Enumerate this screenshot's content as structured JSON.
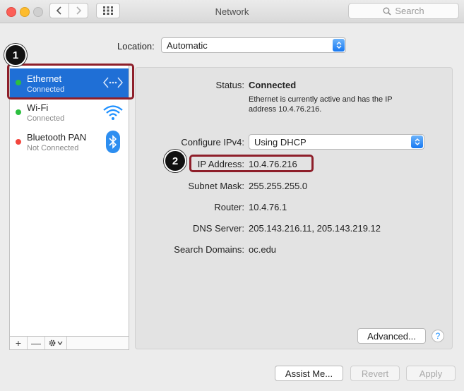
{
  "window": {
    "title": "Network"
  },
  "search": {
    "placeholder": "Search"
  },
  "location": {
    "label": "Location:",
    "value": "Automatic"
  },
  "sidebar": {
    "items": [
      {
        "name": "Ethernet",
        "status": "Connected",
        "dot": "#2cbf3f"
      },
      {
        "name": "Wi-Fi",
        "status": "Connected",
        "dot": "#2cbf3f"
      },
      {
        "name": "Bluetooth PAN",
        "status": "Not Connected",
        "dot": "#f2453d"
      }
    ],
    "toolbar": {
      "add": "+",
      "remove": "—"
    }
  },
  "detail": {
    "status_label": "Status:",
    "status_value": "Connected",
    "status_desc_1": "Ethernet is currently active and has the IP",
    "status_desc_2": "address 10.4.76.216.",
    "configure_label": "Configure IPv4:",
    "configure_value": "Using DHCP",
    "ip_label": "IP Address:",
    "ip_value": "10.4.76.216",
    "subnet_label": "Subnet Mask:",
    "subnet_value": "255.255.255.0",
    "router_label": "Router:",
    "router_value": "10.4.76.1",
    "dns_label": "DNS Server:",
    "dns_value": "205.143.216.11, 205.143.219.12",
    "domains_label": "Search Domains:",
    "domains_value": "oc.edu",
    "advanced": "Advanced...",
    "help": "?"
  },
  "footer": {
    "assist": "Assist Me...",
    "revert": "Revert",
    "apply": "Apply"
  },
  "annotations": {
    "badge1": "1",
    "badge2": "2"
  },
  "colors": {
    "selection": "#1f6fd6",
    "highlight": "#8e1f2a",
    "accent": "#1778f2"
  }
}
